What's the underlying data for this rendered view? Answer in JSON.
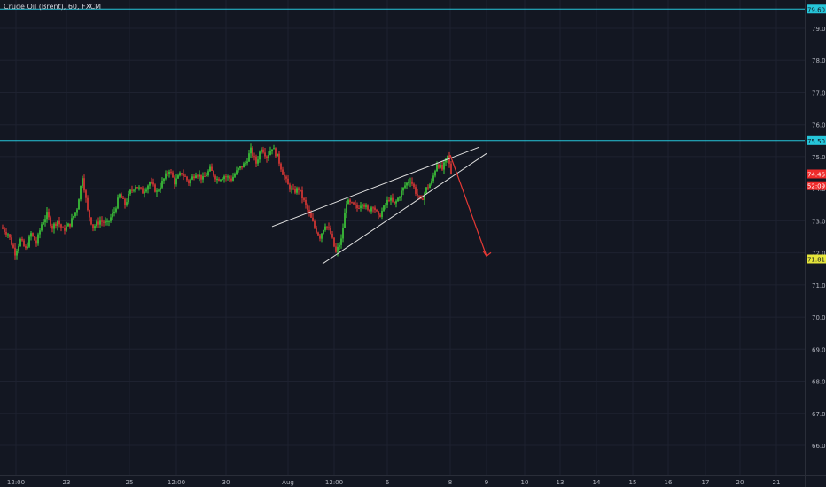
{
  "chart_data": {
    "type": "candlestick",
    "title": "Crude Oil (Brent), 60, FXCM",
    "yticks": [
      "79.00",
      "78.00",
      "77.00",
      "76.00",
      "75.00",
      "74.00",
      "73.00",
      "72.00",
      "71.00",
      "70.00",
      "69.00",
      "68.00",
      "67.00",
      "66.00"
    ],
    "xticks": [
      "12:00",
      "23",
      "25",
      "12:00",
      "30",
      "Aug",
      "12:00",
      "6",
      "8",
      "9",
      "10",
      "13",
      "14",
      "15",
      "16",
      "17",
      "20",
      "21"
    ],
    "ylim": [
      65.4,
      80.6
    ],
    "grid": true,
    "hlines": [
      {
        "value": 79.6,
        "label": "79.60",
        "color": "#26c6da"
      },
      {
        "value": 75.5,
        "label": "75.50",
        "color": "#26c6da"
      },
      {
        "value": 71.81,
        "label": "71.81",
        "color": "#e5e53a"
      }
    ],
    "price_tags": [
      {
        "value": 74.46,
        "label": "74.46",
        "color": "#ef2b2b"
      },
      {
        "value": 74.15,
        "label": "52:09",
        "color": "#ef2b2b"
      }
    ],
    "annotations": {
      "wedge_upper": {
        "from": [
          72.82,
          "Aug-1"
        ],
        "to": [
          75.3,
          "Aug-8"
        ]
      },
      "wedge_lower": {
        "from": [
          71.66,
          "Aug-1"
        ],
        "to": [
          75.1,
          "Aug-8"
        ]
      },
      "target_arrow": {
        "from": [
          75.05,
          "Aug-8"
        ],
        "to": [
          71.9,
          "Aug-9"
        ]
      }
    },
    "colors": {
      "up": "#3fd13a",
      "down": "#e53935",
      "bg": "#131722",
      "grid": "#1e2230",
      "axis_text": "#b2b5be"
    }
  }
}
